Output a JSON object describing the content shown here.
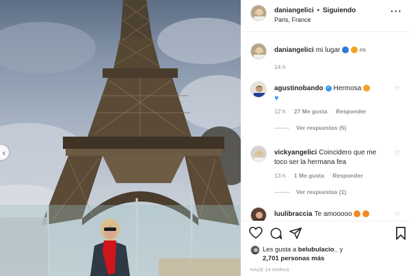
{
  "header": {
    "username": "daniangelici",
    "separator": "•",
    "follow_status": "Siguiendo",
    "location": "Paris, France",
    "more_label": "···"
  },
  "caption": {
    "username": "daniangelici",
    "text": "mi lugar",
    "flag_text": "FR",
    "time": "14 h"
  },
  "comments": [
    {
      "username": "agustinobando",
      "verified": true,
      "text": "Hermosa",
      "time": "12 h",
      "likes": "27 Me gusta",
      "reply": "Responder",
      "view_replies": "Ver respuestas (5)"
    },
    {
      "username": "vickyangelici",
      "text": "Coincidero que me toco ser la hermana fea",
      "time": "13 h",
      "likes": "1 Me gusta",
      "reply": "Responder",
      "view_replies": "Ver respuestas (1)"
    },
    {
      "username": "luulibraccia",
      "text": "Te amooooo"
    }
  ],
  "likes_summary": {
    "prefix": "Les gusta a",
    "user": "belubulacio_",
    "joiner": "y",
    "count": "2,701 personas más"
  },
  "timestamp": "HACE 14 HORAS",
  "colors": {
    "text": "#262626",
    "muted": "#8e8e8e",
    "verified": "#3897f0",
    "scarf": "#d0141c"
  }
}
